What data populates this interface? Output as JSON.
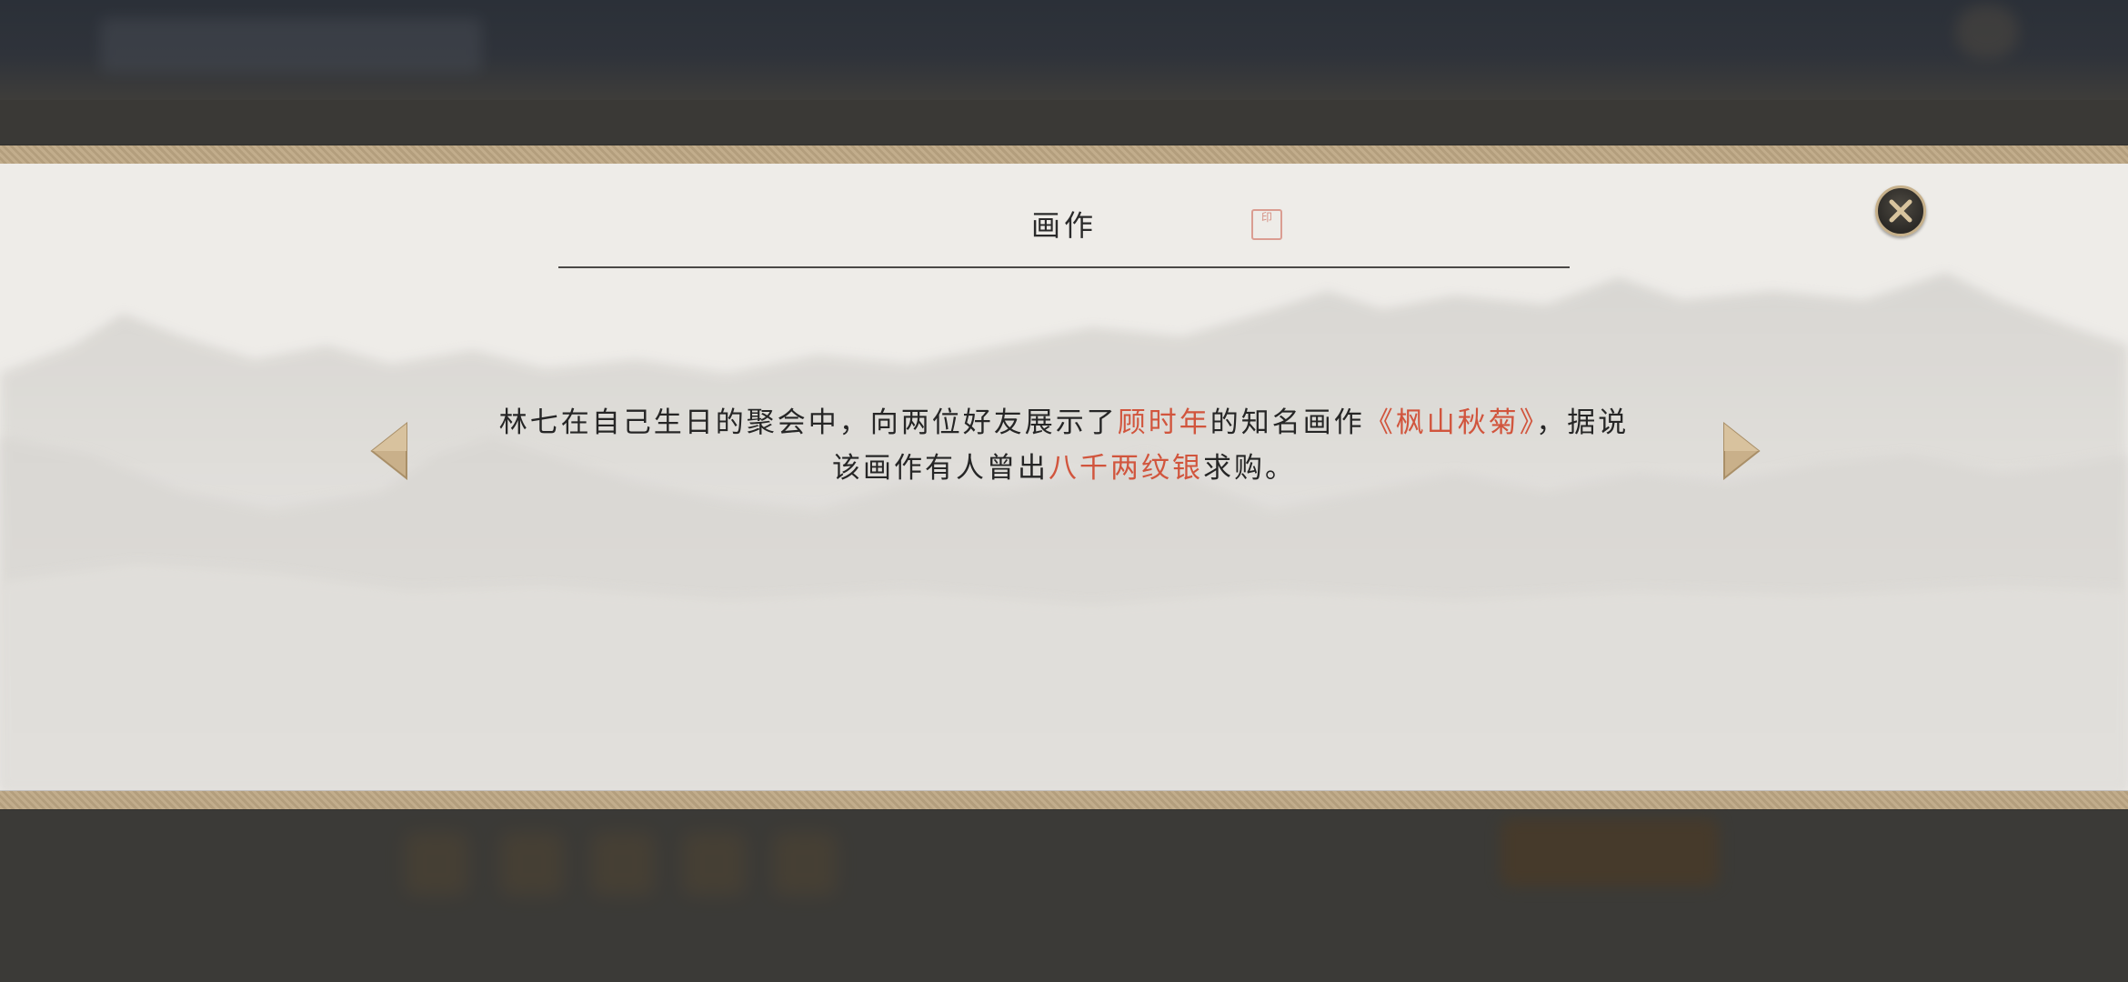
{
  "dialog": {
    "title": "画作",
    "seal_text": "印"
  },
  "description": {
    "part1": "林七在自己生日的聚会中，向两位好友展示了",
    "highlight1": "顾时年",
    "part2": "的知名画作",
    "highlight2": "《枫山秋菊》",
    "part3": "，据说该画作有人曾出",
    "highlight3": "八千两纹银",
    "part4": "求购。"
  },
  "icons": {
    "close": "close-icon",
    "prev": "left-arrow-icon",
    "next": "right-arrow-icon",
    "seal": "seal-stamp-icon"
  },
  "colors": {
    "highlight": "#d1553d",
    "text": "#262626",
    "paper": "#eeece8",
    "border": "#c2ad8c"
  }
}
